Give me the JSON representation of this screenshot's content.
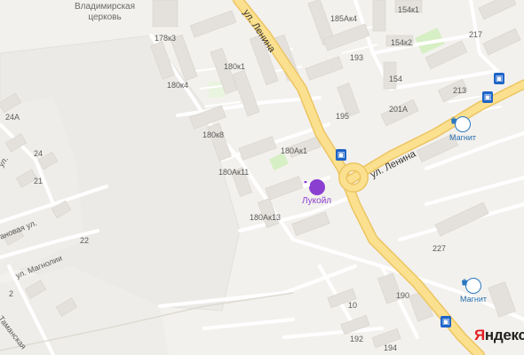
{
  "map": {
    "street_labels": {
      "lenina_north": "ул. Ленина",
      "lenina_east": "ул. Ленина",
      "west_road": "ановая ул.",
      "magnolii": "ул. Магнолии",
      "tamanskaya": "Таманская",
      "small_west": "ул."
    },
    "area_labels": {
      "church": "Владимирская\nцерковь"
    },
    "house_numbers": [
      "178к3",
      "180к1",
      "180к4",
      "180к8",
      "180Ак1",
      "180Ак11",
      "180Ак13",
      "185Ак4",
      "154к1",
      "154к2",
      "217",
      "193",
      "154",
      "213",
      "195",
      "201А",
      "24А",
      "24",
      "21",
      "22",
      "227",
      "190",
      "10",
      "192",
      "194",
      "2"
    ],
    "pois": {
      "lukoil": "Лукойл",
      "magnit_north": "Магнит",
      "magnit_south": "Магнит"
    },
    "colors": {
      "background": "#f3f1ed",
      "road_main": "#fbe08f",
      "road_main_border": "#ecc562",
      "road_minor": "#ffffff",
      "building": "#e4e1dc",
      "park": "#d7efc4",
      "industrial": "#ebe9e5",
      "lukoil": "#8a3fd0",
      "magnit": "#2a78c0",
      "bus_stop": "#1e64c8"
    },
    "icons": [
      "fuel-icon",
      "shop-icon",
      "bus-stop-icon"
    ],
    "logo": {
      "first": "Я",
      "rest": "ндекс"
    }
  }
}
